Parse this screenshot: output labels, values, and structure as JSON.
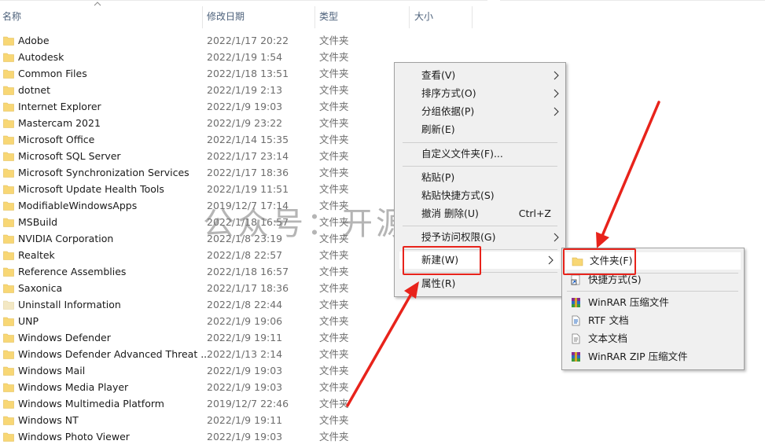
{
  "header": {
    "col_name": "名称",
    "col_date": "修改日期",
    "col_type": "类型",
    "col_size": "大小"
  },
  "files": [
    {
      "name": "Adobe",
      "date": "2022/1/17 20:22",
      "type": "文件夹"
    },
    {
      "name": "Autodesk",
      "date": "2022/1/19 1:54",
      "type": "文件夹"
    },
    {
      "name": "Common Files",
      "date": "2022/1/18 13:51",
      "type": "文件夹"
    },
    {
      "name": "dotnet",
      "date": "2022/1/19 2:13",
      "type": "文件夹"
    },
    {
      "name": "Internet Explorer",
      "date": "2022/1/9 19:03",
      "type": "文件夹"
    },
    {
      "name": "Mastercam 2021",
      "date": "2022/1/9 23:22",
      "type": "文件夹"
    },
    {
      "name": "Microsoft Office",
      "date": "2022/1/14 15:35",
      "type": "文件夹"
    },
    {
      "name": "Microsoft SQL Server",
      "date": "2022/1/17 23:14",
      "type": "文件夹"
    },
    {
      "name": "Microsoft Synchronization Services",
      "date": "2022/1/17 18:36",
      "type": "文件夹"
    },
    {
      "name": "Microsoft Update Health Tools",
      "date": "2022/1/19 11:51",
      "type": "文件夹"
    },
    {
      "name": "ModifiableWindowsApps",
      "date": "2019/12/7 17:14",
      "type": "文件夹"
    },
    {
      "name": "MSBuild",
      "date": "2022/1/18 16:57",
      "type": "文件夹"
    },
    {
      "name": "NVIDIA Corporation",
      "date": "2022/1/8 23:19",
      "type": "文件夹"
    },
    {
      "name": "Realtek",
      "date": "2022/1/8 22:57",
      "type": "文件夹"
    },
    {
      "name": "Reference Assemblies",
      "date": "2022/1/18 16:57",
      "type": "文件夹"
    },
    {
      "name": "Saxonica",
      "date": "2022/1/17 18:36",
      "type": "文件夹"
    },
    {
      "name": "Uninstall Information",
      "date": "2022/1/8 22:44",
      "type": "文件夹"
    },
    {
      "name": "UNP",
      "date": "2022/1/9 19:06",
      "type": "文件夹"
    },
    {
      "name": "Windows Defender",
      "date": "2022/1/9 19:11",
      "type": "文件夹"
    },
    {
      "name": "Windows Defender Advanced Threat ...",
      "date": "2022/1/13 2:14",
      "type": "文件夹"
    },
    {
      "name": "Windows Mail",
      "date": "2022/1/9 19:03",
      "type": "文件夹"
    },
    {
      "name": "Windows Media Player",
      "date": "2022/1/9 19:03",
      "type": "文件夹"
    },
    {
      "name": "Windows Multimedia Platform",
      "date": "2019/12/7 22:46",
      "type": "文件夹"
    },
    {
      "name": "Windows NT",
      "date": "2022/1/9 19:11",
      "type": "文件夹"
    },
    {
      "name": "Windows Photo Viewer",
      "date": "2022/1/9 19:03",
      "type": "文件夹"
    }
  ],
  "context_menu": {
    "view": "查看(V)",
    "sort_by": "排序方式(O)",
    "group_by": "分组依据(P)",
    "refresh": "刷新(E)",
    "customize_folder": "自定义文件夹(F)...",
    "paste": "粘贴(P)",
    "paste_shortcut": "粘贴快捷方式(S)",
    "undo_delete": "撤消 删除(U)",
    "undo_shortcut": "Ctrl+Z",
    "grant_access": "授予访问权限(G)",
    "new": "新建(W)",
    "properties": "属性(R)"
  },
  "new_submenu": {
    "folder": "文件夹(F)",
    "shortcut": "快捷方式(S)",
    "winrar_archive": "WinRAR 压缩文件",
    "rtf_document": "RTF 文档",
    "text_document": "文本文档",
    "winrar_zip": "WinRAR ZIP 压缩文件"
  },
  "watermark": "公众号：开源神器",
  "colors": {
    "folder_yellow": "#f8d775",
    "annotation_red": "#e8231b",
    "menu_bg": "#f0f0f0",
    "header_text": "#4c607a"
  }
}
